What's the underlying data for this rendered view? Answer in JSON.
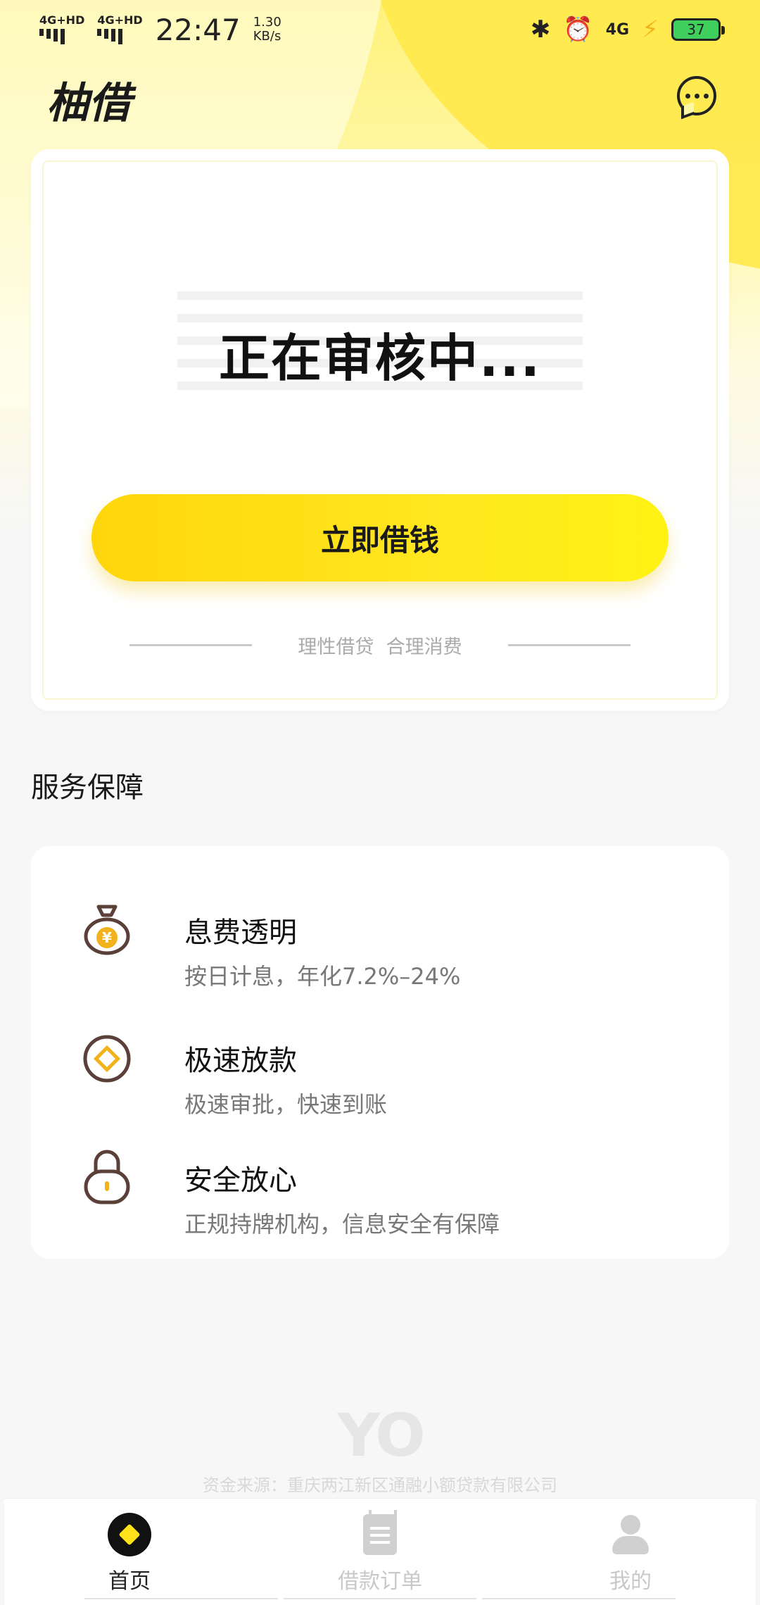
{
  "status_bar": {
    "sim1": "4G+HD",
    "sim2": "4G+HD",
    "time": "22:47",
    "speed_value": "1.30",
    "speed_unit": "KB/s",
    "network": "4G",
    "battery": "37"
  },
  "header": {
    "title": "柚借"
  },
  "main_card": {
    "status_text": "正在审核中...",
    "borrow_button": "立即借钱",
    "slogan": "理性借贷  合理消费"
  },
  "services": {
    "section_title": "服务保障",
    "items": [
      {
        "title": "息费透明",
        "desc": "按日计息，年化7.2%–24%",
        "icon": "money-bag-icon"
      },
      {
        "title": "极速放款",
        "desc": "极速审批，快速到账",
        "icon": "coin-icon"
      },
      {
        "title": "安全放心",
        "desc": "正规持牌机构，信息安全有保障",
        "icon": "lock-icon"
      }
    ]
  },
  "footer": {
    "brand": "YO",
    "fund_source": "资金来源：重庆两江新区通融小额贷款有限公司"
  },
  "tab_bar": {
    "tabs": [
      {
        "label": "首页",
        "active": true
      },
      {
        "label": "借款订单",
        "active": false
      },
      {
        "label": "我的",
        "active": false
      }
    ]
  },
  "colors": {
    "accent_yellow": "#ffe21a",
    "icon_brown": "#5a4038",
    "icon_gold": "#f2b21c"
  }
}
